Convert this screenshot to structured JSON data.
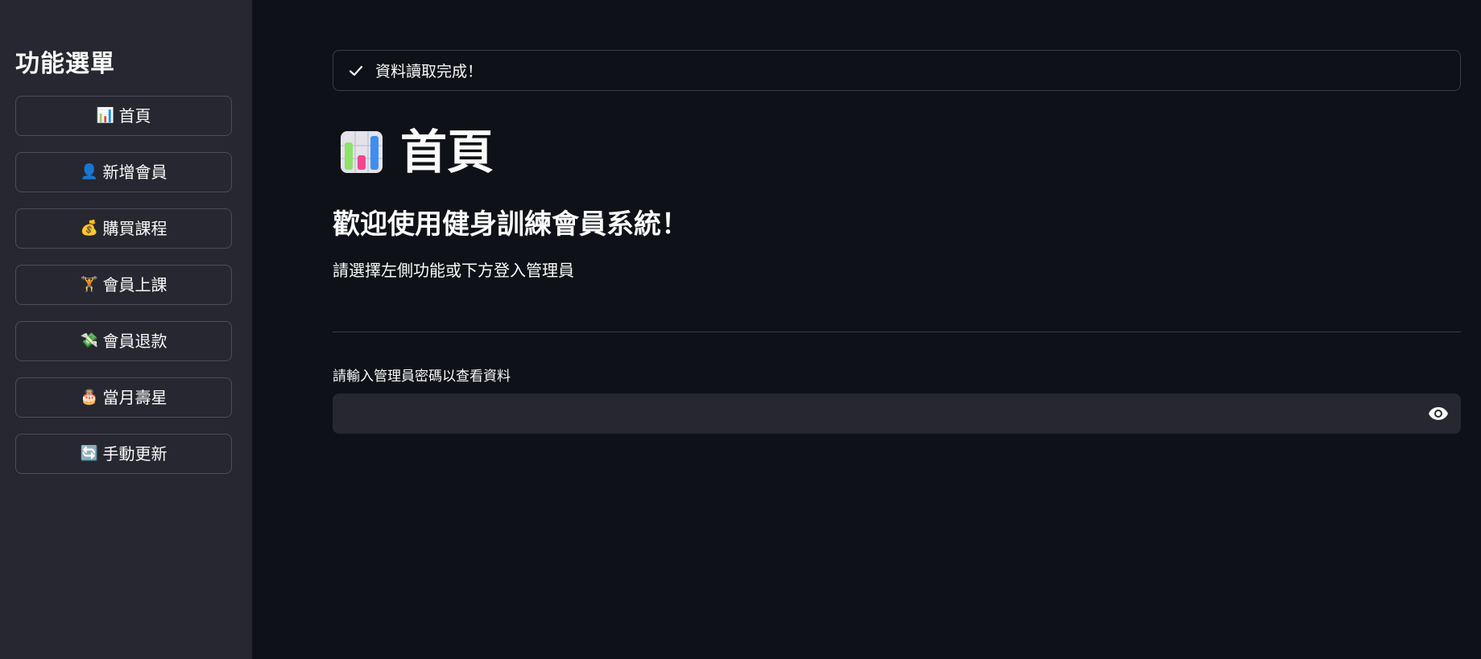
{
  "sidebar": {
    "title": "功能選單",
    "items": [
      {
        "label": "首頁",
        "icon": "📊",
        "icon_name": "bar-chart-icon"
      },
      {
        "label": "新增會員",
        "icon": "👤",
        "icon_name": "person-icon"
      },
      {
        "label": "購買課程",
        "icon": "💰",
        "icon_name": "money-bag-icon"
      },
      {
        "label": "會員上課",
        "icon": "🏋",
        "icon_name": "weightlifter-icon"
      },
      {
        "label": "會員退款",
        "icon": "💸",
        "icon_name": "money-with-wings-icon"
      },
      {
        "label": "當月壽星",
        "icon": "🎂",
        "icon_name": "birthday-cake-icon"
      },
      {
        "label": "手動更新",
        "icon": "🔄",
        "icon_name": "refresh-icon"
      }
    ]
  },
  "main": {
    "alert": {
      "text": "資料讀取完成！",
      "icon_name": "check-icon"
    },
    "title": "首頁",
    "title_icon_name": "bar-chart-icon",
    "welcome": "歡迎使用健身訓練會員系統！",
    "hint": "請選擇左側功能或下方登入管理員",
    "password": {
      "label": "請輸入管理員密碼以查看資料",
      "value": "",
      "placeholder": "",
      "toggle_icon_name": "eye-icon"
    }
  },
  "colors": {
    "background": "#0e1117",
    "sidebar": "#262730",
    "text": "#fafafa",
    "border": "#4c4e58"
  }
}
